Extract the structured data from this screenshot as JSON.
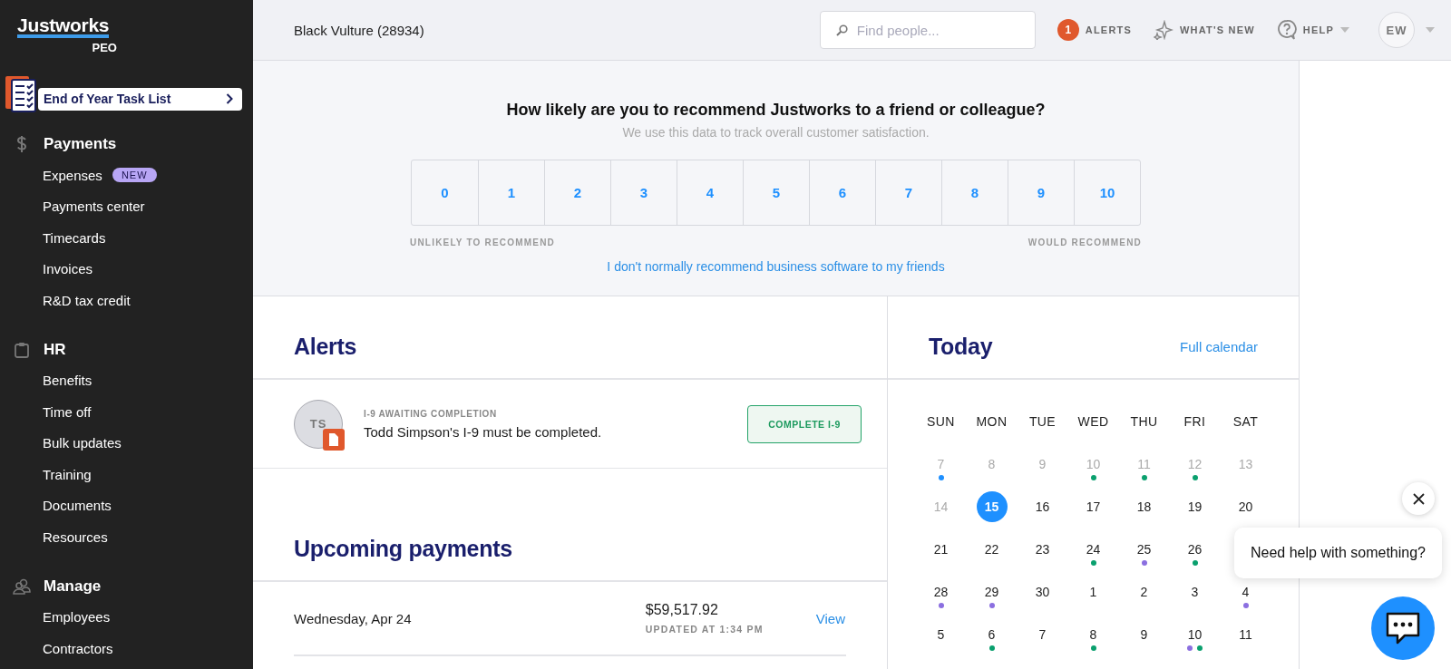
{
  "sidebar": {
    "logo": "Justworks",
    "logo_sub": "PEO",
    "task_list": "End of Year Task List",
    "sections": [
      {
        "title": "Payments",
        "items": [
          {
            "label": "Expenses",
            "badge": "NEW"
          },
          {
            "label": "Payments center"
          },
          {
            "label": "Timecards"
          },
          {
            "label": "Invoices"
          },
          {
            "label": "R&D tax credit"
          }
        ]
      },
      {
        "title": "HR",
        "items": [
          {
            "label": "Benefits"
          },
          {
            "label": "Time off"
          },
          {
            "label": "Bulk updates"
          },
          {
            "label": "Training"
          },
          {
            "label": "Documents"
          },
          {
            "label": "Resources"
          }
        ]
      },
      {
        "title": "Manage",
        "items": [
          {
            "label": "Employees"
          },
          {
            "label": "Contractors"
          }
        ]
      }
    ]
  },
  "topbar": {
    "company": "Black Vulture (28934)",
    "search": {
      "placeholder": "Find people..."
    },
    "alerts_count": "1",
    "alerts": "ALERTS",
    "whats_new": "WHAT'S NEW",
    "help": "HELP",
    "avatar": "EW"
  },
  "survey": {
    "question": "How likely are you to recommend Justworks to a friend or colleague?",
    "subtitle": "We use this data to track overall customer satisfaction.",
    "scores": [
      "0",
      "1",
      "2",
      "3",
      "4",
      "5",
      "6",
      "7",
      "8",
      "9",
      "10"
    ],
    "low_label": "UNLIKELY TO RECOMMEND",
    "high_label": "WOULD RECOMMEND",
    "opt_out": "I don't normally recommend business software to my friends"
  },
  "alerts": {
    "title": "Alerts",
    "items": [
      {
        "initials": "TS",
        "category": "I-9 AWAITING COMPLETION",
        "message": "Todd Simpson's I-9 must be completed.",
        "action": "COMPLETE I-9"
      }
    ]
  },
  "payments": {
    "title": "Upcoming payments",
    "items": [
      {
        "date": "Wednesday, Apr 24",
        "amount": "$59,517.92",
        "updated": "UPDATED AT 1:34 PM",
        "action": "View"
      }
    ]
  },
  "calendar": {
    "title": "Today",
    "link": "Full calendar",
    "weekdays": [
      "SUN",
      "MON",
      "TUE",
      "WED",
      "THU",
      "FRI",
      "SAT"
    ],
    "weeks": [
      [
        {
          "day": "7",
          "past": true,
          "selected": false,
          "events": [
            {
              "color": "#1e90ff"
            }
          ]
        },
        {
          "day": "8",
          "past": true,
          "selected": false
        },
        {
          "day": "9",
          "past": true,
          "selected": false
        },
        {
          "day": "10",
          "past": true,
          "selected": false,
          "events": [
            {
              "color": "#0aa06e"
            }
          ]
        },
        {
          "day": "11",
          "past": true,
          "selected": false,
          "events": [
            {
              "color": "#0aa06e"
            }
          ]
        },
        {
          "day": "12",
          "past": true,
          "selected": false,
          "events": [
            {
              "color": "#0aa06e"
            }
          ]
        },
        {
          "day": "13",
          "past": true,
          "selected": false
        }
      ],
      [
        {
          "day": "14",
          "past": true,
          "selected": false
        },
        {
          "day": "15",
          "past": false,
          "selected": true
        },
        {
          "day": "16",
          "past": false,
          "selected": false
        },
        {
          "day": "17",
          "past": false,
          "selected": false
        },
        {
          "day": "18",
          "past": false,
          "selected": false
        },
        {
          "day": "19",
          "past": false,
          "selected": false
        },
        {
          "day": "20",
          "past": false,
          "selected": false
        }
      ],
      [
        {
          "day": "21",
          "past": false,
          "selected": false
        },
        {
          "day": "22",
          "past": false,
          "selected": false
        },
        {
          "day": "23",
          "past": false,
          "selected": false
        },
        {
          "day": "24",
          "past": false,
          "selected": false,
          "events": [
            {
              "color": "#0aa06e"
            }
          ]
        },
        {
          "day": "25",
          "past": false,
          "selected": false,
          "events": [
            {
              "color": "#8b6fe0"
            }
          ]
        },
        {
          "day": "26",
          "past": false,
          "selected": false,
          "events": [
            {
              "color": "#0aa06e"
            }
          ]
        }
      ],
      [
        {
          "day": "28",
          "past": false,
          "selected": false,
          "events": [
            {
              "color": "#8b6fe0"
            }
          ]
        },
        {
          "day": "29",
          "past": false,
          "selected": false,
          "events": [
            {
              "color": "#8b6fe0"
            }
          ]
        },
        {
          "day": "30",
          "past": false,
          "selected": false
        },
        {
          "day": "1",
          "past": false,
          "selected": false
        },
        {
          "day": "2",
          "past": false,
          "selected": false
        },
        {
          "day": "3",
          "past": false,
          "selected": false
        },
        {
          "day": "4",
          "past": false,
          "selected": false,
          "events": [
            {
              "color": "#8b6fe0"
            }
          ]
        }
      ],
      [
        {
          "day": "5",
          "past": false,
          "selected": false
        },
        {
          "day": "6",
          "past": false,
          "selected": false,
          "events": [
            {
              "color": "#0aa06e"
            }
          ]
        },
        {
          "day": "7",
          "past": false,
          "selected": false
        },
        {
          "day": "8",
          "past": false,
          "selected": false,
          "events": [
            {
              "color": "#0aa06e"
            }
          ]
        },
        {
          "day": "9",
          "past": false,
          "selected": false
        },
        {
          "day": "10",
          "past": false,
          "selected": false,
          "events": [
            {
              "color": "#8b6fe0"
            },
            {
              "color": "#0aa06e"
            }
          ]
        },
        {
          "day": "11",
          "past": false,
          "selected": false
        }
      ]
    ]
  },
  "chat": {
    "prompt": "Need help with something?"
  }
}
